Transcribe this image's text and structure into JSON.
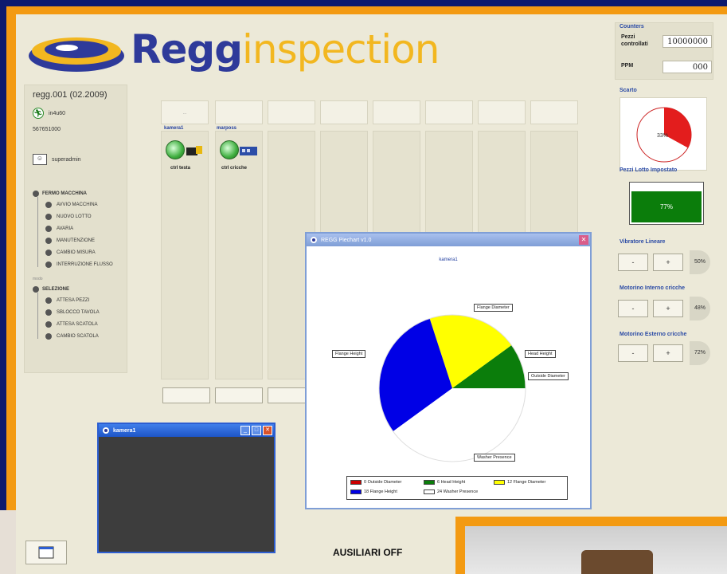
{
  "logo": {
    "text_bold": "Regg",
    "text_light": "inspection"
  },
  "machine": {
    "id": "regg.001 (02.2009)",
    "status_label": "in4u60",
    "code": "567651000",
    "user": "superadmin"
  },
  "state_tree": {
    "group1_title": "FERMO MACCHINA",
    "group1_items": [
      "AVVIO MACCHINA",
      "NUOVO LOTTO",
      "AVARIA",
      "MANUTENZIONE",
      "CAMBIO MISURA",
      "INTERRUZIONE FLUSSO"
    ],
    "note": "modo",
    "group2_title": "SELEZIONE",
    "group2_items": [
      "ATTESA PEZZI",
      "SBLOCCO TAVOLA",
      "ATTESA SCATOLA",
      "CAMBIO SCATOLA"
    ]
  },
  "columns": {
    "first_header": "...",
    "devices": [
      {
        "cam": "kamera1",
        "name": "ctrl testa"
      },
      {
        "cam": "marposs",
        "name": "ctrl cricche"
      }
    ]
  },
  "right": {
    "counters_title": "Counters",
    "pezzi_label": "Pezzi controllati",
    "pezzi_value": "10000000",
    "ppm_label": "PPM",
    "ppm_value": "000",
    "scarto_title": "Scarto",
    "scarto_pct": "33%",
    "lotto_title": "Pezzi Lotto Impostato",
    "lotto_pct": "77%",
    "lotto_fraction": 0.77,
    "vibratore_title": "Vibratore Lineare",
    "vibratore_pct": "50%",
    "motorino_int_title": "Motorino Interno cricche",
    "motorino_int_pct": "48%",
    "motorino_est_title": "Motorino Esterno cricche",
    "motorino_est_pct": "72%",
    "minus": "-",
    "plus": "+"
  },
  "popup": {
    "title": "REGG Piechart v1.0",
    "chart_title": "kamera1",
    "callout_flange_diameter": "Flange Diameter",
    "callout_head_height": "Head Height",
    "callout_outside_diameter": "Outside Diameter",
    "callout_flange_height": "Flange Height",
    "callout_washer_presence": "Washer Presence"
  },
  "chart_data": {
    "type": "pie",
    "title": "kamera1",
    "slices": [
      {
        "label": "Outside Diameter",
        "value": 0,
        "color": "#cc0000",
        "legend": "0 Outside Diameter"
      },
      {
        "label": "Head Height",
        "value": 6,
        "color": "#0b7d0b",
        "legend": "6 Head Height"
      },
      {
        "label": "Flange Diameter",
        "value": 12,
        "color": "#ffff00",
        "legend": "12 Flange Diameter"
      },
      {
        "label": "Flange Height",
        "value": 18,
        "color": "#0000e6",
        "legend": "18 Flange Height"
      },
      {
        "label": "Washer Presence",
        "value": 24,
        "color": "#ffffff",
        "legend": "24 Washer Presence"
      }
    ]
  },
  "camwin": {
    "title": "kamera1"
  },
  "footer": {
    "status": "AUSILIARI OFF"
  }
}
